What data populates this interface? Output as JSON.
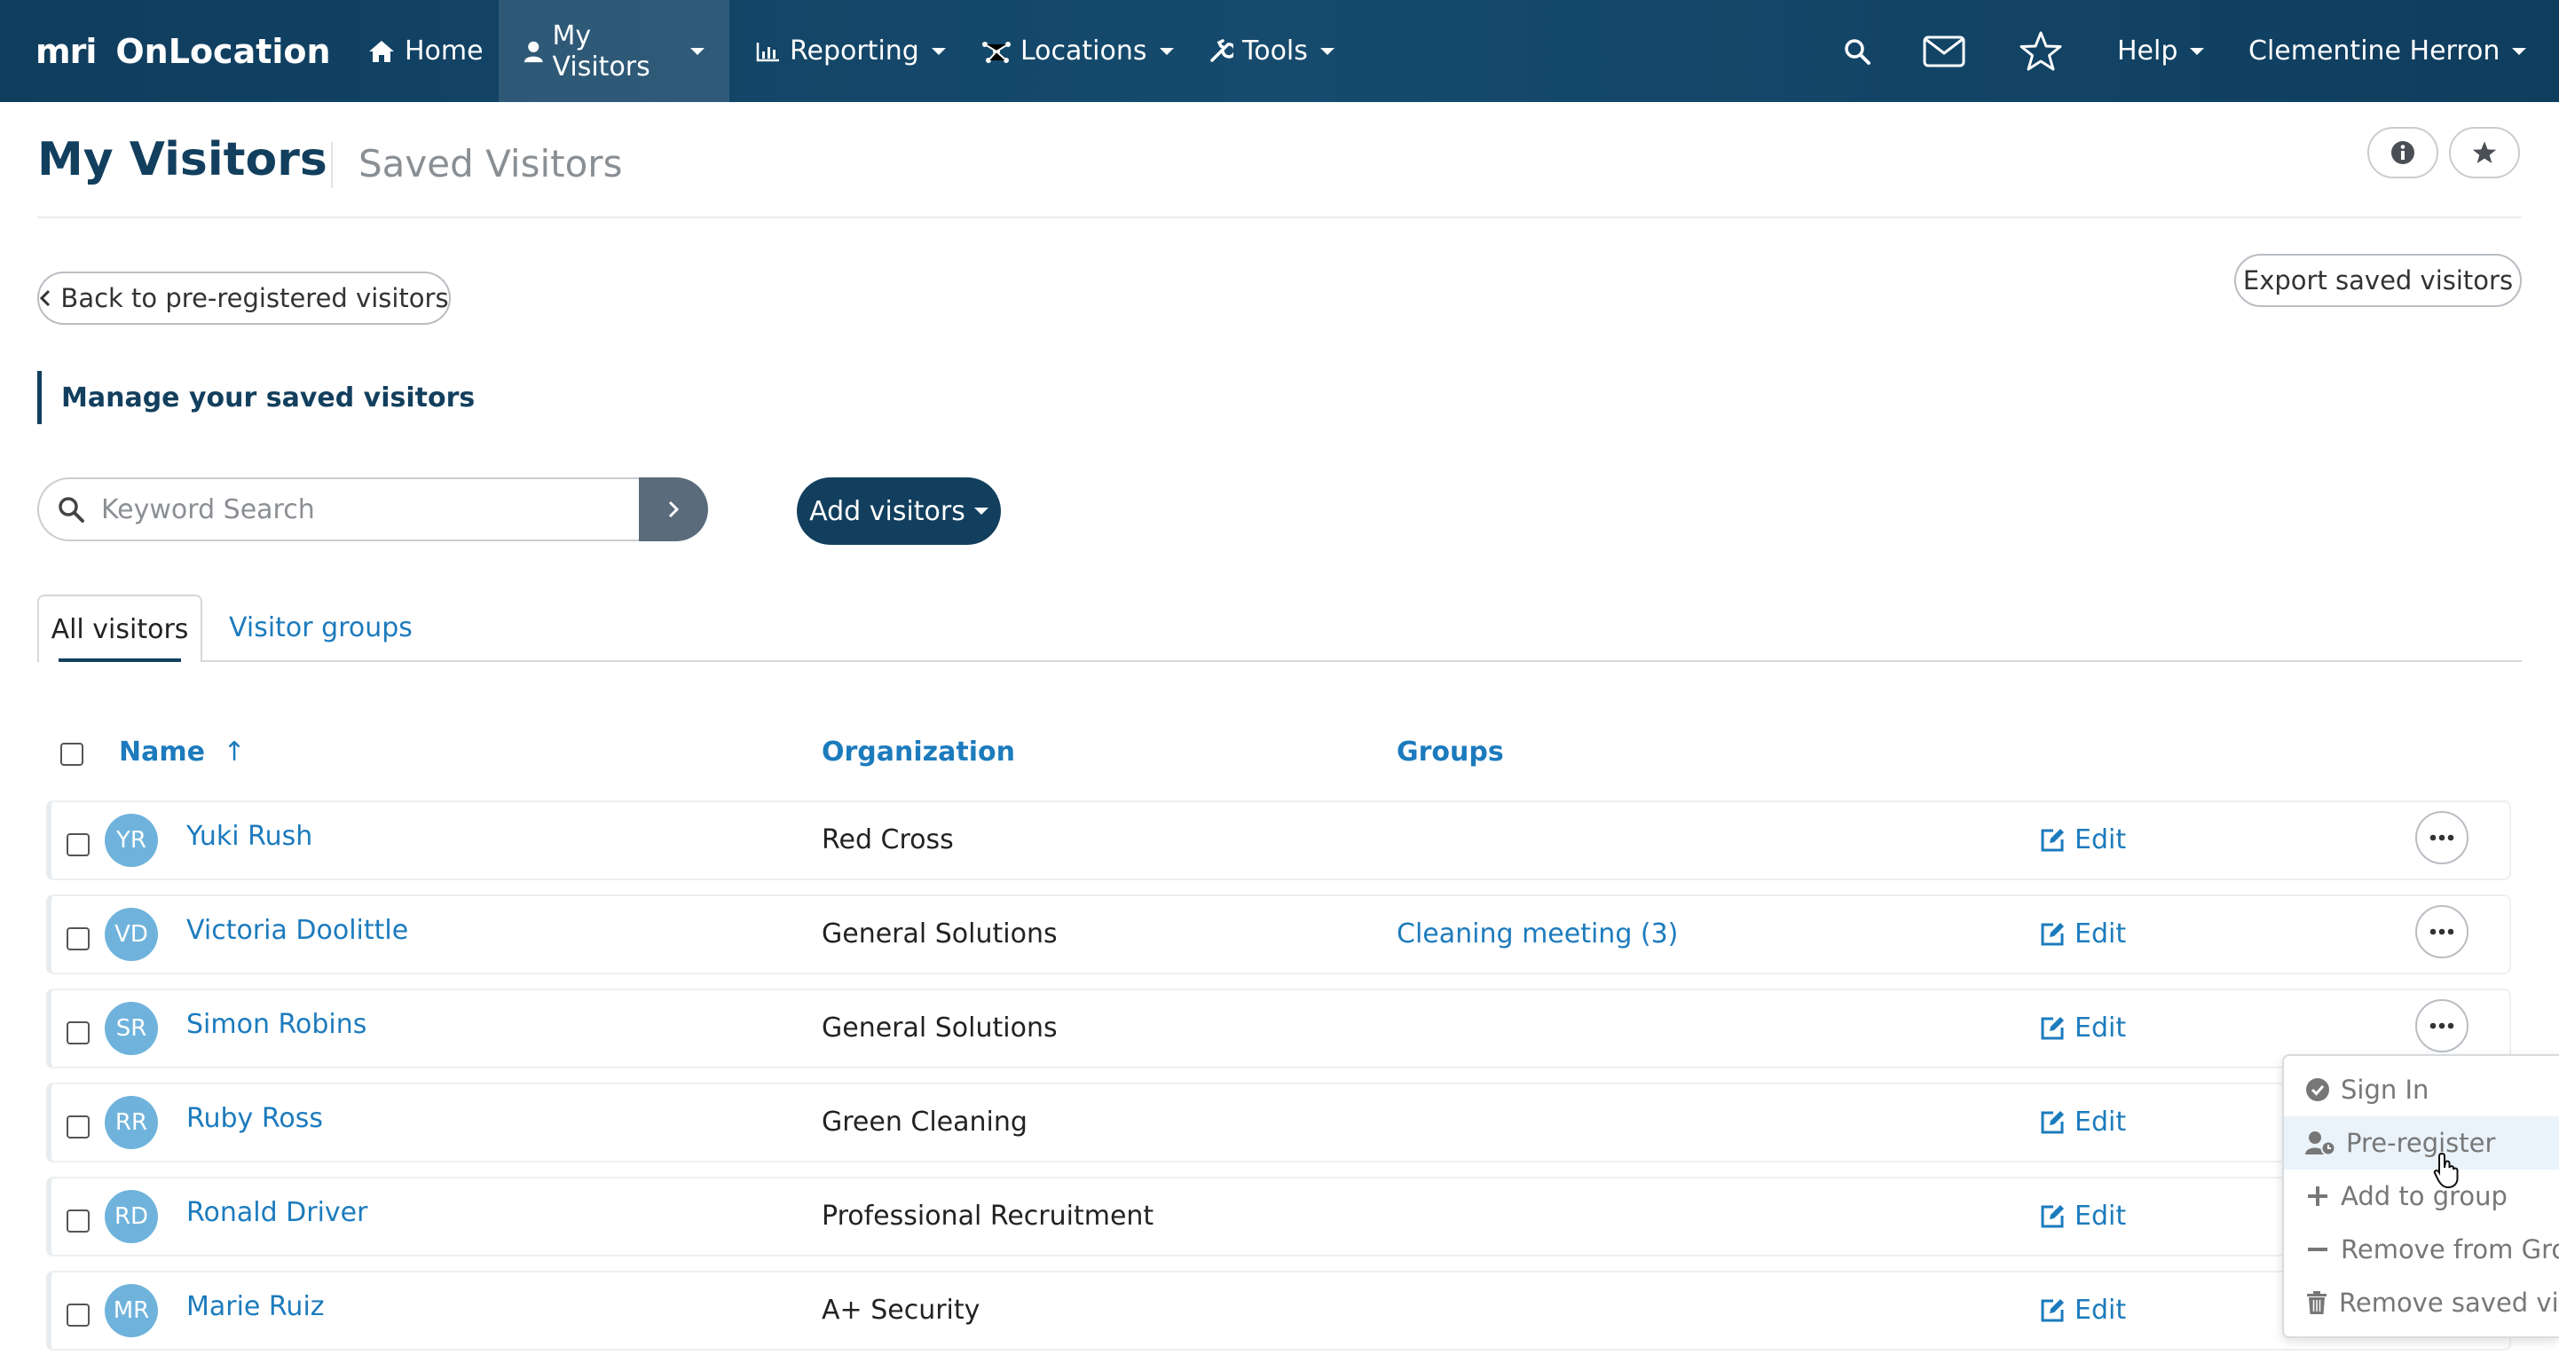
{
  "app": {
    "logo_mark": "mri",
    "logo_text": "OnLocation"
  },
  "nav": {
    "home": "Home",
    "my_visitors": "My Visitors",
    "reporting": "Reporting",
    "locations": "Locations",
    "tools": "Tools",
    "help": "Help",
    "user": "Clementine Herron"
  },
  "header": {
    "title": "My Visitors",
    "subtitle": "Saved Visitors"
  },
  "actions": {
    "back": "Back to pre-registered visitors",
    "export": "Export saved visitors",
    "section_label": "Manage your saved visitors",
    "add_visitors": "Add visitors"
  },
  "search": {
    "placeholder": "Keyword Search",
    "value": ""
  },
  "tabs": {
    "all": "All visitors",
    "groups": "Visitor groups"
  },
  "table": {
    "col_name": "Name",
    "sort_arrow": "↑",
    "col_org": "Organization",
    "col_groups": "Groups",
    "edit_label": "Edit",
    "rows": [
      {
        "initials": "YR",
        "name": "Yuki Rush",
        "org": "Red Cross",
        "groups": ""
      },
      {
        "initials": "VD",
        "name": "Victoria Doolittle",
        "org": "General Solutions",
        "groups": "Cleaning meeting (3)"
      },
      {
        "initials": "SR",
        "name": "Simon Robins",
        "org": "General Solutions",
        "groups": ""
      },
      {
        "initials": "RR",
        "name": "Ruby Ross",
        "org": "Green Cleaning",
        "groups": ""
      },
      {
        "initials": "RD",
        "name": "Ronald Driver",
        "org": "Professional Recruitment",
        "groups": ""
      },
      {
        "initials": "MR",
        "name": "Marie Ruiz",
        "org": "A+ Security",
        "groups": ""
      }
    ]
  },
  "row_menu": {
    "items": [
      {
        "label": "Sign In",
        "icon": "check-circle-icon"
      },
      {
        "label": "Pre-register",
        "icon": "user-clock-icon"
      },
      {
        "label": "Add to group",
        "icon": "plus-icon"
      },
      {
        "label": "Remove from Group",
        "icon": "minus-icon"
      },
      {
        "label": "Remove saved visitor",
        "icon": "trash-icon"
      }
    ]
  },
  "colors": {
    "nav_bg": "#123f5e",
    "link": "#1c7bbd",
    "avatar": "#6fb3dc"
  }
}
